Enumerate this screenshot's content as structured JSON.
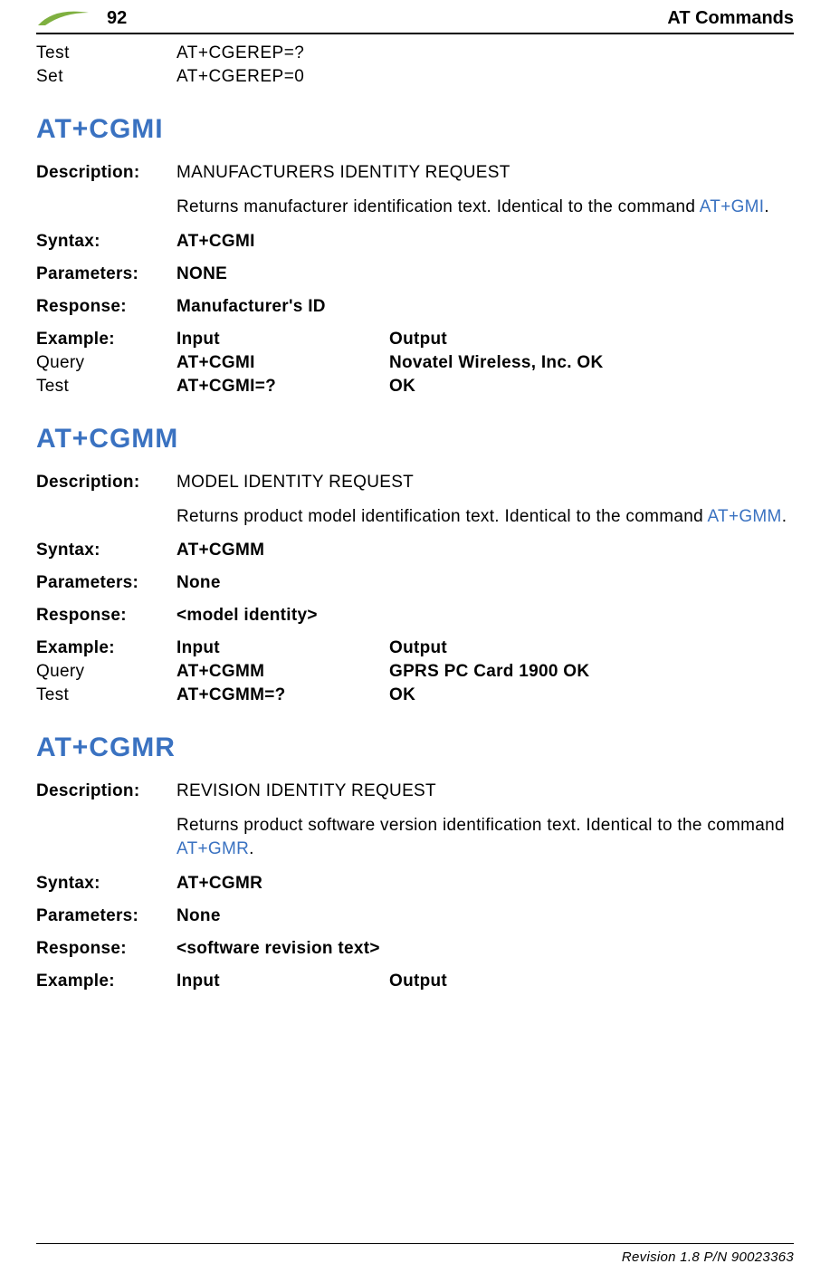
{
  "header": {
    "page_number": "92",
    "title": "AT Commands"
  },
  "pre_rows": [
    {
      "label": "Test",
      "input": "AT+CGEREP=?",
      "output": ""
    },
    {
      "label": "Set",
      "input": "AT+CGEREP=0",
      "output": ""
    }
  ],
  "commands": [
    {
      "title": "AT+CGMI",
      "description_label": "Description:",
      "description_value": "MANUFACTURERS IDENTITY REQUEST",
      "body_pre": "Returns manufacturer identification text. Identical to the command ",
      "body_link": "AT+GMI",
      "body_post": ".",
      "syntax_label": "Syntax:",
      "syntax_value": "AT+CGMI",
      "parameters_label": "Parameters:",
      "parameters_value": "NONE",
      "response_label": "Response:",
      "response_value": "Manufacturer's ID",
      "example_label": "Example:",
      "example_input_header": "Input",
      "example_output_header": "Output",
      "examples": [
        {
          "label": "Query",
          "input": "AT+CGMI",
          "output": "Novatel Wireless, Inc. OK"
        },
        {
          "label": "Test",
          "input": "AT+CGMI=?",
          "output": "OK"
        }
      ]
    },
    {
      "title": "AT+CGMM",
      "description_label": "Description:",
      "description_value": "MODEL IDENTITY REQUEST",
      "body_pre": "Returns product model identification text. Identical to the command ",
      "body_link": "AT+GMM",
      "body_post": ".",
      "syntax_label": "Syntax:",
      "syntax_value": "AT+CGMM",
      "parameters_label": "Parameters:",
      "parameters_value": "None",
      "response_label": "Response:",
      "response_value": "<model identity>",
      "example_label": "Example:",
      "example_input_header": "Input",
      "example_output_header": "Output",
      "examples": [
        {
          "label": "Query",
          "input": "AT+CGMM",
          "output": "GPRS PC Card 1900 OK"
        },
        {
          "label": "Test",
          "input": "AT+CGMM=?",
          "output": "OK"
        }
      ]
    },
    {
      "title": "AT+CGMR",
      "description_label": "Description:",
      "description_value": "REVISION IDENTITY REQUEST",
      "body_pre": "Returns product software version identification text. Identical to the command ",
      "body_link": "AT+GMR",
      "body_post": ".",
      "syntax_label": "Syntax:",
      "syntax_value": "AT+CGMR",
      "parameters_label": "Parameters:",
      "parameters_value": "None",
      "response_label": "Response:",
      "response_value": "<software revision text>",
      "example_label": "Example:",
      "example_input_header": "Input",
      "example_output_header": "Output",
      "examples": []
    }
  ],
  "footer": {
    "text": "Revision 1.8  P/N 90023363"
  }
}
